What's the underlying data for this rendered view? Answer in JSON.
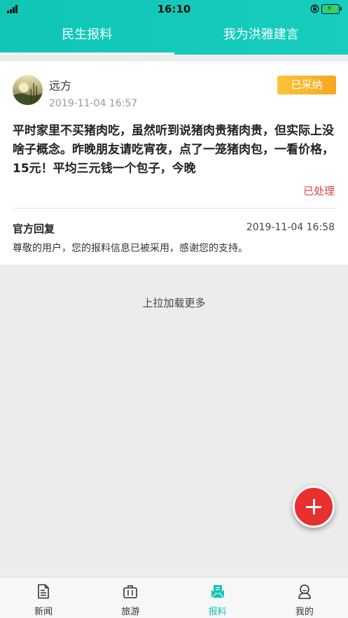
{
  "status_bar": {
    "time": "16:10"
  },
  "tabs": [
    {
      "label": "民生报料",
      "active": true
    },
    {
      "label": "我为洪雅建言",
      "active": false
    }
  ],
  "post": {
    "user_name": "远方",
    "timestamp": "2019-11-04 16:57",
    "badge": "已采纳",
    "content": "平时家里不买猪肉吃，虽然听到说猪肉贵猪肉贵，但实际上没啥子概念。昨晚朋友请吃宵夜，点了一笼猪肉包，一看价格，15元！平均三元钱一个包子，今晚",
    "status": "已处理",
    "reply": {
      "title": "官方回复",
      "timestamp": "2019-11-04 16:58",
      "text": "尊敬的用户，您的报料信息已被采用，感谢您的支持。"
    }
  },
  "load_more": "上拉加载更多",
  "bottom_nav": [
    {
      "label": "新闻",
      "icon": "news-icon",
      "active": false
    },
    {
      "label": "旅游",
      "icon": "suitcase-icon",
      "active": false
    },
    {
      "label": "报料",
      "icon": "report-icon",
      "active": true
    },
    {
      "label": "我的",
      "icon": "profile-icon",
      "active": false
    }
  ],
  "colors": {
    "accent": "#13c3b4",
    "badge": "#f8b52e",
    "status": "#e0443d",
    "fab": "#e8302f"
  }
}
